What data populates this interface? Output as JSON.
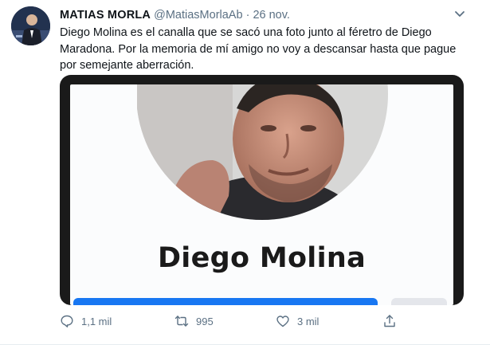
{
  "tweet": {
    "author_name": "MATIAS MORLA",
    "handle": "@MatiasMorlaAb",
    "separator": "·",
    "date": "26 nov.",
    "text": "Diego Molina es el canalla que se sacó una foto junto al féretro de Diego Maradona. Por la memoria de mí amigo no voy a descansar hasta que pague por semejante aberración.",
    "media": {
      "profile_name": "Diego Molina",
      "accent_color": "#1877f2"
    },
    "actions": {
      "replies": "1,1 mil",
      "retweets": "995",
      "likes": "3 mil"
    }
  },
  "icons": {
    "caret": "chevron-down-icon",
    "reply": "comment-icon",
    "retweet": "retweet-icon",
    "like": "heart-icon",
    "share": "share-icon"
  }
}
